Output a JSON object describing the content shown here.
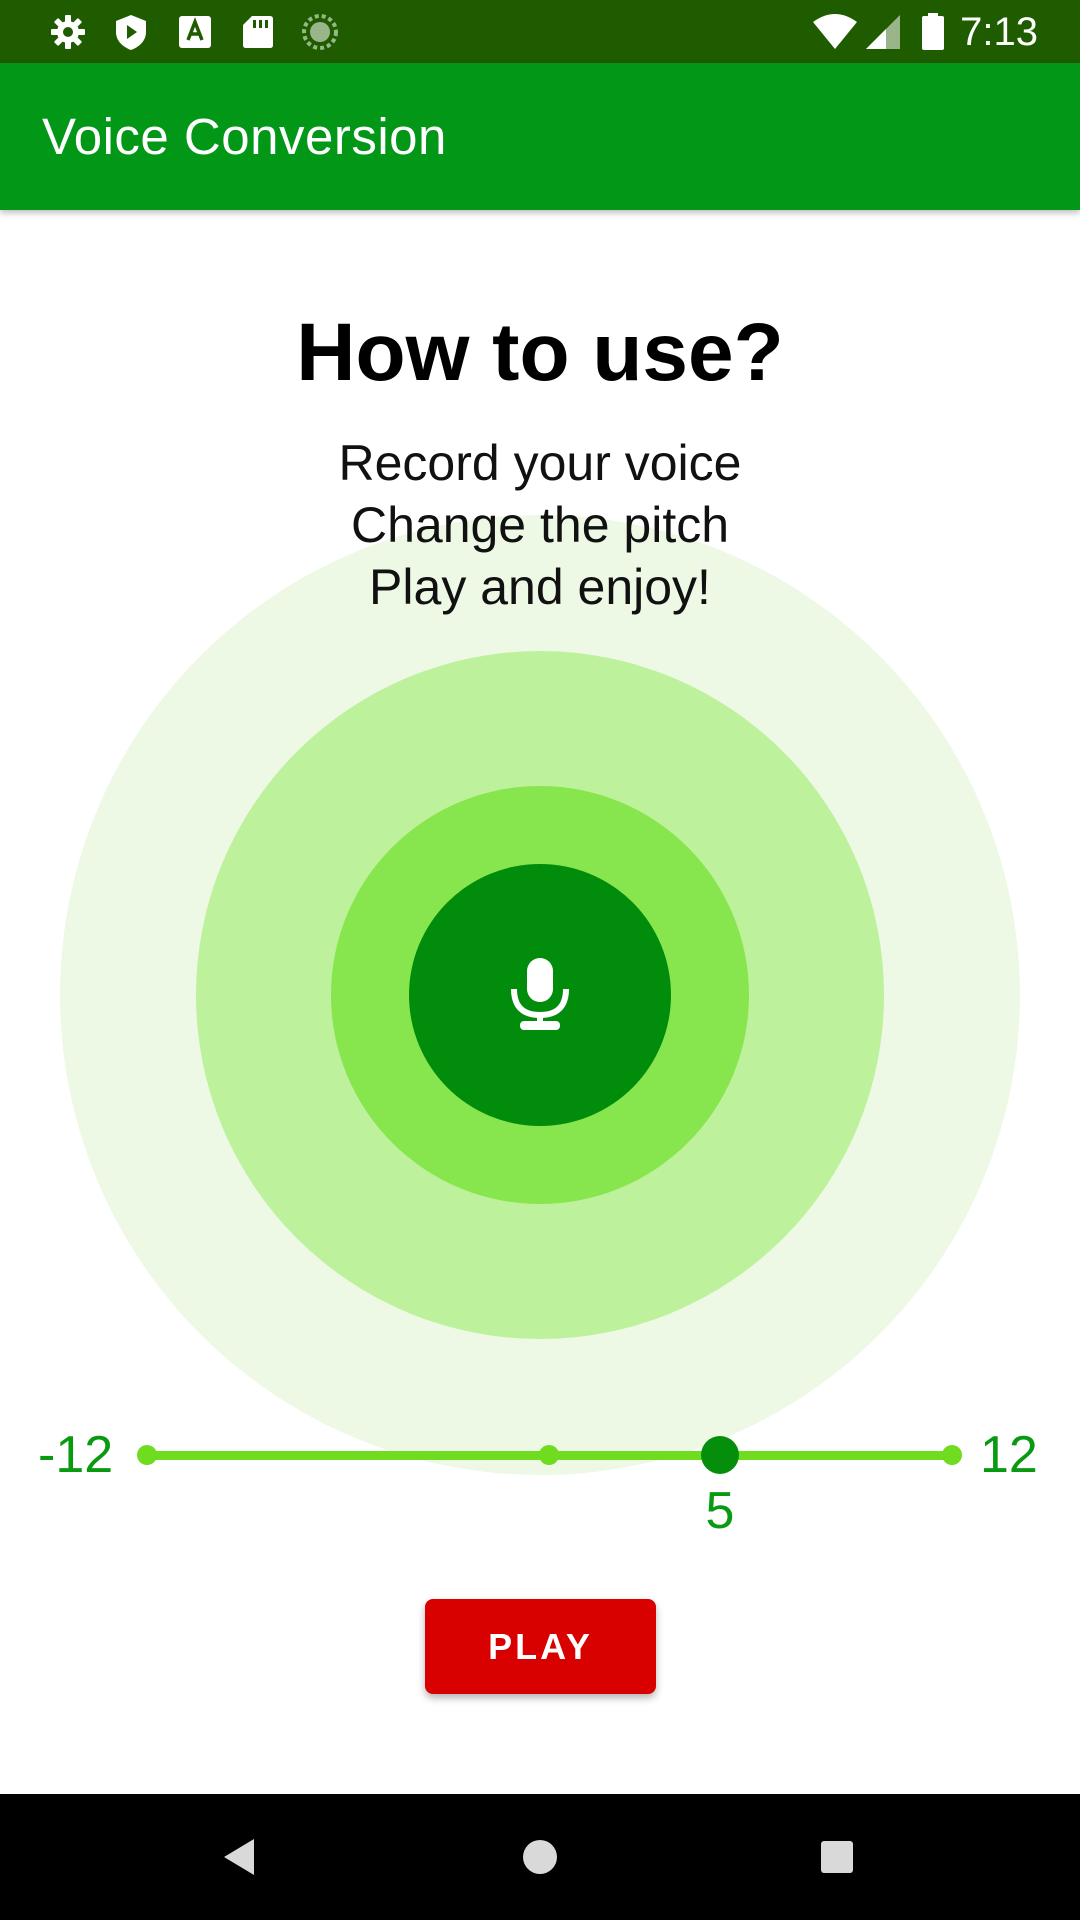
{
  "status_bar": {
    "time": "7:13",
    "left_icons": [
      "settings-icon",
      "shield-icon",
      "text-a-icon",
      "sd-card-icon",
      "sync-icon"
    ],
    "right_icons": [
      "wifi-icon",
      "signal-icon",
      "battery-icon"
    ]
  },
  "app_bar": {
    "title": "Voice Conversion"
  },
  "main": {
    "headline": "How to use?",
    "instructions": [
      "Record your voice",
      "Change the pitch",
      "Play and enjoy!"
    ],
    "mic_icon": "microphone-icon"
  },
  "pitch_slider": {
    "min_label": "-12",
    "max_label": "12",
    "value_label": "5",
    "min": -12,
    "max": 12,
    "value": 5
  },
  "play_button": {
    "label": "PLAY"
  },
  "nav_bar": {
    "icons": [
      "back-icon",
      "home-icon",
      "recents-icon"
    ]
  },
  "colors": {
    "status_bar": "#1f5c00",
    "app_bar": "#029716",
    "ripple_outer": "#edf9e5",
    "ripple_mid": "#bdf19b",
    "ripple_inner": "#87e54d",
    "mic_button": "#028c0c",
    "slider_track": "#6fdc1f",
    "slider_thumb": "#058d0c",
    "play_button": "#d90000"
  }
}
